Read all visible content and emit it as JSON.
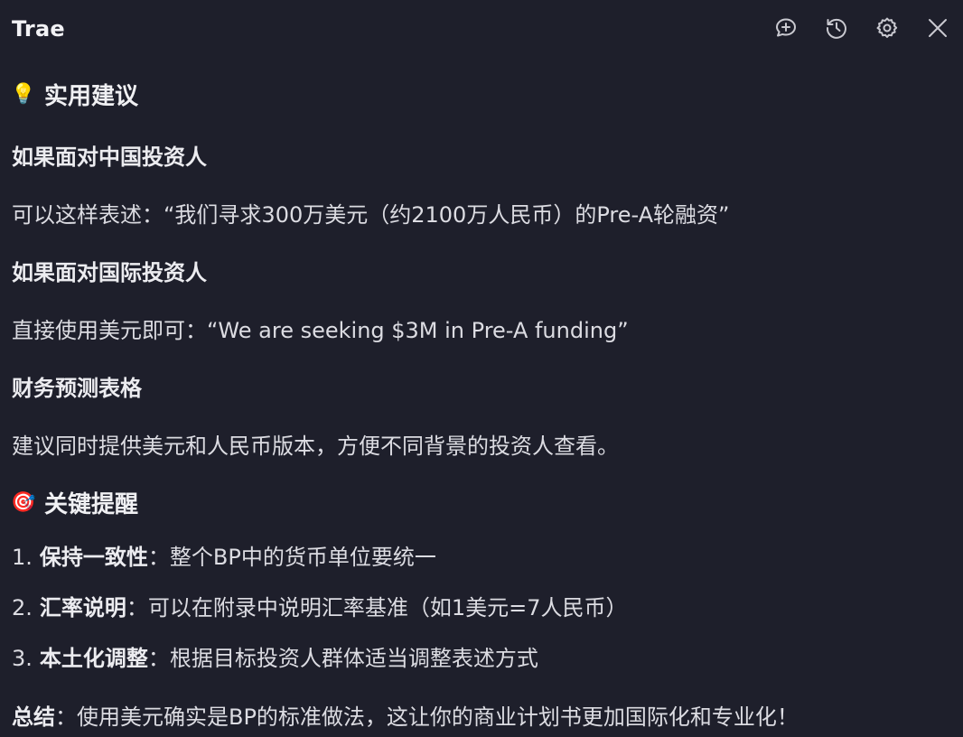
{
  "app": {
    "title": "Trae"
  },
  "header_icons": [
    "add-chat-icon",
    "history-icon",
    "settings-icon",
    "close-icon"
  ],
  "section1": {
    "emoji": "💡",
    "title": "实用建议",
    "sub1": {
      "title": "如果面对中国投资人",
      "text": "可以这样表述：“我们寻求300万美元（约2100万人民币）的Pre-A轮融资”"
    },
    "sub2": {
      "title": "如果面对国际投资人",
      "text": "直接使用美元即可：“We are seeking $3M in Pre-A funding”"
    },
    "sub3": {
      "title": "财务预测表格",
      "text": "建议同时提供美元和人民币版本，方便不同背景的投资人查看。"
    }
  },
  "section2": {
    "emoji": "🎯",
    "title": "关键提醒",
    "items": [
      {
        "num": "1.",
        "bold": "保持一致性",
        "text": "：整个BP中的货币单位要统一"
      },
      {
        "num": "2.",
        "bold": "汇率说明",
        "text": "：可以在附录中说明汇率基准（如1美元=7人民币）"
      },
      {
        "num": "3.",
        "bold": "本土化调整",
        "text": "：根据目标投资人群体适当调整表述方式"
      }
    ]
  },
  "summary": {
    "bold": "总结",
    "text": "：使用美元确实是BP的标准做法，这让你的商业计划书更加国际化和专业化！"
  }
}
